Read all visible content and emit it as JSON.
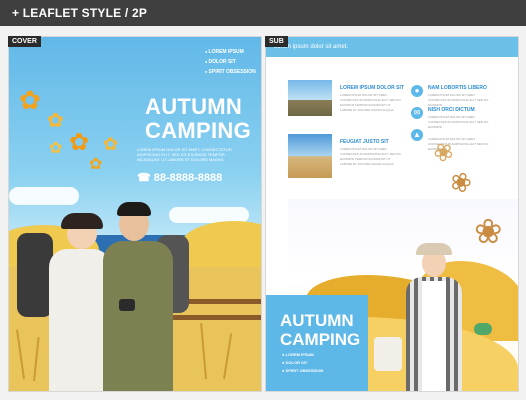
{
  "header": {
    "title": "+ LEAFLET STYLE / 2P"
  },
  "cover": {
    "tag": "COVER",
    "title_line1": "AUTUMN",
    "title_line2": "CAMPING",
    "small_text": "LOREM IPSUM DOLOR SIT AMET, CONSECTETUR ADIPISCING ELIT, SED DO EIUSMOD TEMPOR INCIDIDUNT UT LABORE ET DOLORE MAGNA",
    "phone": "88-8888-8888",
    "list": [
      "LOREM IPSUM",
      "DOLOR SIT",
      "SPIRIT OBSESSION"
    ]
  },
  "sub": {
    "tag": "SUB",
    "banner": "Lorem ipsum dolor sit amet.",
    "blocks": [
      {
        "heading": "LOREM IPSUM DOLOR SIT",
        "text": "LOREM IPSUM DOLOR SIT AMET, CONSECTETUR ADIPISCING ELIT. SED DO EIUSMOD TEMPOR INCIDIDUNT UT LABORE ET DOLORE MAGNA ALIQUA."
      },
      {
        "heading": "FEUGIAT JUSTO SIT",
        "text": "LOREM IPSUM DOLOR SIT AMET, CONSECTETUR ADIPISCING ELIT. SED DO EIUSMOD TEMPOR INCIDIDUNT UT LABORE ET DOLORE MAGNA ALIQUA."
      }
    ],
    "icons": [
      {
        "heading": "NAM LOBORTIS LIBERO",
        "text": "LOREM IPSUM DOLOR SIT AMET, CONSECTETUR ADIPISCING ELIT SED DO EIUSMOD."
      },
      {
        "heading": "NISH ORCI DICTUM",
        "text": "LOREM IPSUM DOLOR SIT AMET, CONSECTETUR ADIPISCING ELIT SED DO EIUSMOD."
      },
      {
        "heading": "",
        "text": "LOREM IPSUM DOLOR SIT AMET, CONSECTETUR ADIPISCING ELIT SED DO EIUSMOD."
      }
    ],
    "title_line1": "AUTUMN",
    "title_line2": "CAMPING",
    "list": [
      "LOREM IPSUM",
      "DOLOR SIT",
      "SPIRIT OBSESSION"
    ]
  }
}
